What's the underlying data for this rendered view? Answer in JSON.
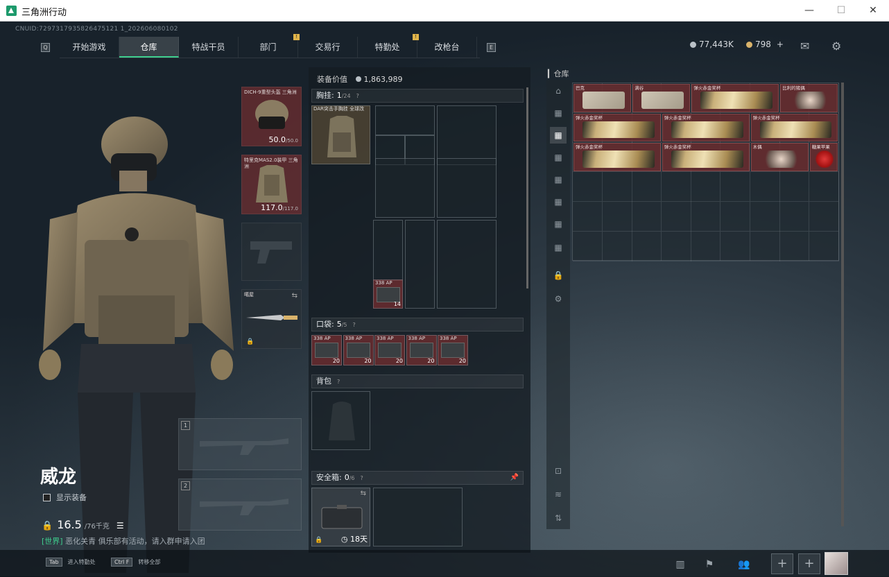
{
  "window": {
    "title": "三角洲行动",
    "min": "—",
    "max": "☐",
    "close": "✕"
  },
  "uid": "CNUID:7297317935826475121 1_202606080102",
  "nav": {
    "tabs": [
      {
        "label": "开始游戏",
        "active": false,
        "badge": ""
      },
      {
        "label": "仓库",
        "active": true,
        "badge": ""
      },
      {
        "label": "特战干员",
        "active": false,
        "badge": ""
      },
      {
        "label": "部门",
        "active": false,
        "badge": "!"
      },
      {
        "label": "交易行",
        "active": false,
        "badge": ""
      },
      {
        "label": "特勤处",
        "active": false,
        "badge": "!"
      },
      {
        "label": "改枪台",
        "active": false,
        "badge": ""
      }
    ],
    "left_key": "Q",
    "right_key": "E"
  },
  "currency": {
    "silver": "77,443K",
    "gold": "798",
    "plus": "+",
    "silver_color": "#b9c0c6",
    "gold_color": "#d9b36b"
  },
  "character": {
    "name": "威龙",
    "show_gear": "显示装备",
    "weight": "16.5",
    "weight_max": "/76千克"
  },
  "chat": {
    "channel": "[世界]",
    "text": "恶化关青 俱乐部有活动，请入群申请入团"
  },
  "hotkeys": [
    {
      "key": "Tab",
      "label": "进入特勤处"
    },
    {
      "key": "Ctrl F",
      "label": "转移全部"
    }
  ],
  "equip": {
    "helmet": {
      "label": "DICH-9重型头盔 三角洲",
      "durability": "50.0",
      "max": "/50.0"
    },
    "armor": {
      "label": "特里克MAS2.0装甲 三角洲",
      "durability": "117.0",
      "max": "/117.0"
    },
    "melee": {
      "label": "噶屋"
    },
    "weapon_slots": [
      "1",
      "2"
    ]
  },
  "center": {
    "equip_value_label": "装备价值",
    "equip_value": "1,863,989",
    "chest": {
      "title": "胸挂:",
      "count": "1",
      "cap": "/24",
      "item": "DAR突击手胸挂 全球改"
    },
    "pocket": {
      "title": "口袋:",
      "count": "5",
      "cap": "/5"
    },
    "backpack": {
      "title": "背包"
    },
    "safebox": {
      "title": "安全箱:",
      "count": "0",
      "cap": "/6",
      "days": "18天"
    },
    "ammo_label": "338 AP",
    "chest_ammo_qty": "14",
    "pocket_qty": [
      "20",
      "20",
      "20",
      "20",
      "20"
    ]
  },
  "warehouse": {
    "title": "仓库",
    "items": [
      {
        "label": "巴克",
        "col": 0,
        "row": 0,
        "w": 2,
        "h": 1,
        "kind": "map"
      },
      {
        "label": "满谷",
        "col": 2,
        "row": 0,
        "w": 2,
        "h": 1,
        "kind": "map"
      },
      {
        "label": "弹火赤金奖杯",
        "col": 4,
        "row": 0,
        "w": 3,
        "h": 1,
        "kind": "gold"
      },
      {
        "label": "比利的猪偶",
        "col": 7,
        "row": 0,
        "w": 2,
        "h": 1,
        "kind": "doll"
      },
      {
        "label": "弹火赤金奖杯",
        "col": 0,
        "row": 1,
        "w": 3,
        "h": 1,
        "kind": "gold"
      },
      {
        "label": "弹火赤金奖杯",
        "col": 3,
        "row": 1,
        "w": 3,
        "h": 1,
        "kind": "gold"
      },
      {
        "label": "弹火赤金奖杯",
        "col": 6,
        "row": 1,
        "w": 3,
        "h": 1,
        "kind": "gold"
      },
      {
        "label": "弹火赤金奖杯",
        "col": 0,
        "row": 2,
        "w": 3,
        "h": 1,
        "kind": "gold"
      },
      {
        "label": "弹火赤金奖杯",
        "col": 3,
        "row": 2,
        "w": 3,
        "h": 1,
        "kind": "gold"
      },
      {
        "label": "木偶",
        "col": 6,
        "row": 2,
        "w": 2,
        "h": 1,
        "kind": "doll"
      },
      {
        "label": "糖果苹果",
        "col": 8,
        "row": 2,
        "w": 1,
        "h": 1,
        "kind": "apple"
      }
    ]
  }
}
